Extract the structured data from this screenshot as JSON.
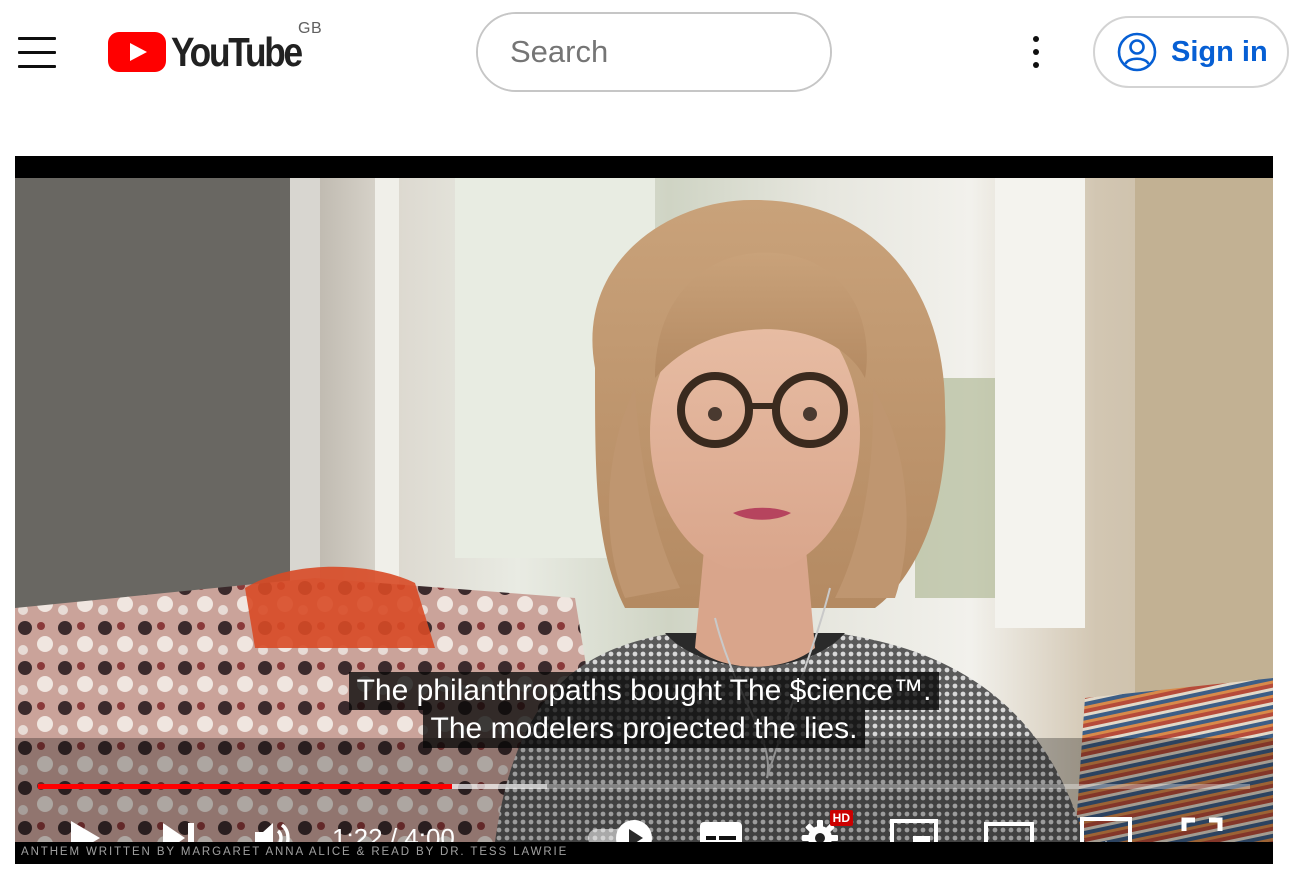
{
  "header": {
    "menu_icon": "hamburger-menu-icon",
    "logo_text": "YouTube",
    "country_code": "GB",
    "search": {
      "placeholder": "Search",
      "value": ""
    },
    "search_icon": "search-icon",
    "more_icon": "kebab-menu-icon",
    "signin_label": "Sign in",
    "signin_icon": "account-circle-icon",
    "brand_color": "#ff0000",
    "link_color": "#065fd4"
  },
  "player": {
    "captions": [
      "The philanthropaths bought The $cience™.",
      "The modelers projected the lies."
    ],
    "current_time": "1:22",
    "duration": "4:00",
    "time_display": "1:22 / 4:00",
    "played_fraction": 0.3417,
    "buffered_fraction": 0.42,
    "credit_text": "ANTHEM WRITTEN BY MARGARET ANNA ALICE & READ BY DR. TESS LAWRIE",
    "hd_badge": "HD",
    "controls": [
      "play-icon",
      "next-icon",
      "volume-icon",
      "autoplay-toggle-icon",
      "subtitles-icon",
      "settings-icon",
      "miniplayer-icon",
      "theater-mode-icon",
      "airplay-icon",
      "fullscreen-icon"
    ],
    "progress_color": "#ff0000"
  }
}
